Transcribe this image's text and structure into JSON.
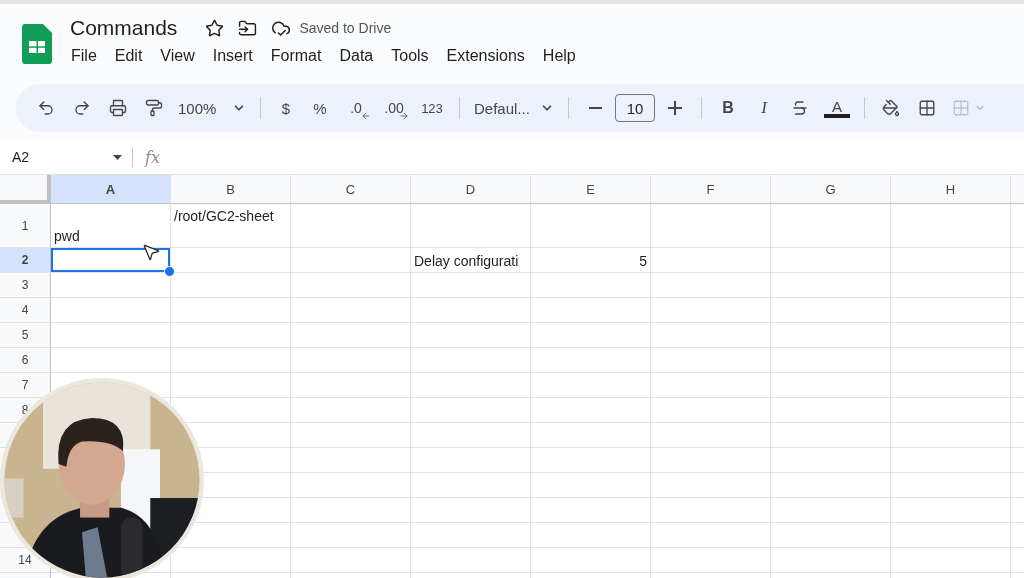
{
  "document": {
    "title": "Commands",
    "save_status": "Saved to Drive"
  },
  "menu": [
    "File",
    "Edit",
    "View",
    "Insert",
    "Format",
    "Data",
    "Tools",
    "Extensions",
    "Help"
  ],
  "toolbar": [
    {
      "kind": "undo"
    },
    {
      "kind": "redo"
    },
    {
      "kind": "print"
    },
    {
      "kind": "paintformat"
    },
    {
      "kind": "dropdown",
      "label": "100%"
    },
    {
      "kind": "separator"
    },
    {
      "kind": "text",
      "label": "$"
    },
    {
      "kind": "text",
      "label": "%"
    },
    {
      "kind": "lessdecimal",
      "label": ".0"
    },
    {
      "kind": "moredecimal",
      "label": ".00"
    },
    {
      "kind": "text",
      "label": "123"
    },
    {
      "kind": "separator"
    },
    {
      "kind": "dropdown",
      "label": "Defaul..."
    },
    {
      "kind": "separator"
    },
    {
      "kind": "minus"
    },
    {
      "kind": "field",
      "label": "10"
    },
    {
      "kind": "plus"
    },
    {
      "kind": "separator"
    },
    {
      "kind": "bold",
      "label": "B"
    },
    {
      "kind": "italic",
      "label": "I"
    },
    {
      "kind": "strike"
    },
    {
      "kind": "textcolor",
      "label": "A"
    },
    {
      "kind": "separator"
    },
    {
      "kind": "fill"
    },
    {
      "kind": "borders"
    },
    {
      "kind": "merge",
      "disabled": true
    }
  ],
  "name_box": "A2",
  "formula_label": "fx",
  "columns": [
    {
      "label": "A",
      "selected": true
    },
    {
      "label": "B",
      "selected": false
    },
    {
      "label": "C",
      "selected": false
    },
    {
      "label": "D",
      "selected": false
    },
    {
      "label": "E",
      "selected": false
    },
    {
      "label": "F",
      "selected": false
    },
    {
      "label": "G",
      "selected": false
    },
    {
      "label": "H",
      "selected": false
    }
  ],
  "rows": [
    {
      "label": "1",
      "selected": false,
      "tall": true,
      "cells": [
        {
          "kind": "text",
          "text": "pwd",
          "active": false
        },
        {
          "kind": "wrapped",
          "text": "/root/GC2-sheet",
          "active": false
        }
      ]
    },
    {
      "label": "2",
      "selected": true,
      "cells": [
        {
          "kind": "empty",
          "active": true
        },
        {
          "kind": "empty",
          "active": false
        },
        {
          "kind": "empty",
          "active": false
        },
        {
          "kind": "text",
          "text": "Delay configurati",
          "active": false
        },
        {
          "kind": "number",
          "text": "5",
          "active": false
        }
      ]
    },
    {
      "label": "3",
      "selected": false
    },
    {
      "label": "4",
      "selected": false
    },
    {
      "label": "5",
      "selected": false
    },
    {
      "label": "6",
      "selected": false
    },
    {
      "label": "7",
      "selected": false
    },
    {
      "label": "8",
      "selected": false
    },
    {
      "selected": false
    },
    {
      "selected": false
    },
    {
      "selected": false
    },
    {
      "selected": false
    },
    {
      "selected": false
    },
    {
      "label": "14",
      "selected": false
    },
    {
      "selected": false
    }
  ]
}
